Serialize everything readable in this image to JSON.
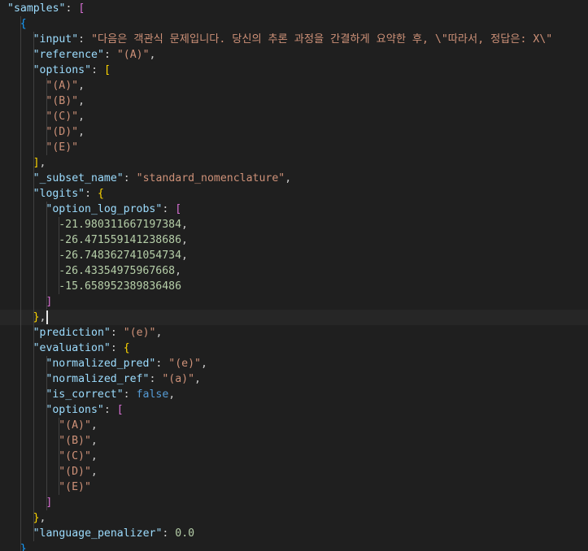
{
  "editor": {
    "language": "json",
    "colors": {
      "background": "#1f1f1f",
      "key": "#9cdcfe",
      "string": "#ce9178",
      "number": "#b5cea8",
      "keyword": "#569cd6",
      "punctuation": "#cccccc",
      "bracket_level1": "#ffd700",
      "bracket_level2": "#da70d6",
      "bracket_level3": "#179fff",
      "current_line": "#262626"
    },
    "lines": [
      {
        "indent": 0,
        "tokens": [
          {
            "t": "key",
            "v": "\"samples\""
          },
          {
            "t": "punct",
            "v": ": "
          },
          {
            "t": "b2",
            "v": "["
          }
        ]
      },
      {
        "indent": 1,
        "tokens": [
          {
            "t": "b3",
            "v": "{"
          }
        ]
      },
      {
        "indent": 2,
        "tokens": [
          {
            "t": "key",
            "v": "\"input\""
          },
          {
            "t": "punct",
            "v": ": "
          },
          {
            "t": "str",
            "v": "\"다음은 객관식 문제입니다. 당신의 추론 과정을 간결하게 요약한 후, \\\"따라서, 정답은: X\\\""
          }
        ]
      },
      {
        "indent": 2,
        "tokens": [
          {
            "t": "key",
            "v": "\"reference\""
          },
          {
            "t": "punct",
            "v": ": "
          },
          {
            "t": "str",
            "v": "\"(A)\""
          },
          {
            "t": "punct",
            "v": ","
          }
        ]
      },
      {
        "indent": 2,
        "tokens": [
          {
            "t": "key",
            "v": "\"options\""
          },
          {
            "t": "punct",
            "v": ": "
          },
          {
            "t": "b1",
            "v": "["
          }
        ]
      },
      {
        "indent": 3,
        "tokens": [
          {
            "t": "str",
            "v": "\"(A)\""
          },
          {
            "t": "punct",
            "v": ","
          }
        ]
      },
      {
        "indent": 3,
        "tokens": [
          {
            "t": "str",
            "v": "\"(B)\""
          },
          {
            "t": "punct",
            "v": ","
          }
        ]
      },
      {
        "indent": 3,
        "tokens": [
          {
            "t": "str",
            "v": "\"(C)\""
          },
          {
            "t": "punct",
            "v": ","
          }
        ]
      },
      {
        "indent": 3,
        "tokens": [
          {
            "t": "str",
            "v": "\"(D)\""
          },
          {
            "t": "punct",
            "v": ","
          }
        ]
      },
      {
        "indent": 3,
        "tokens": [
          {
            "t": "str",
            "v": "\"(E)\""
          }
        ]
      },
      {
        "indent": 2,
        "tokens": [
          {
            "t": "b1",
            "v": "]"
          },
          {
            "t": "punct",
            "v": ","
          }
        ]
      },
      {
        "indent": 2,
        "tokens": [
          {
            "t": "key",
            "v": "\"_subset_name\""
          },
          {
            "t": "punct",
            "v": ": "
          },
          {
            "t": "str",
            "v": "\"standard_nomenclature\""
          },
          {
            "t": "punct",
            "v": ","
          }
        ]
      },
      {
        "indent": 2,
        "tokens": [
          {
            "t": "key",
            "v": "\"logits\""
          },
          {
            "t": "punct",
            "v": ": "
          },
          {
            "t": "b1",
            "v": "{"
          }
        ]
      },
      {
        "indent": 3,
        "tokens": [
          {
            "t": "key",
            "v": "\"option_log_probs\""
          },
          {
            "t": "punct",
            "v": ": "
          },
          {
            "t": "b2",
            "v": "["
          }
        ]
      },
      {
        "indent": 4,
        "tokens": [
          {
            "t": "num",
            "v": "-21.980311667197384"
          },
          {
            "t": "punct",
            "v": ","
          }
        ]
      },
      {
        "indent": 4,
        "tokens": [
          {
            "t": "num",
            "v": "-26.471559141238686"
          },
          {
            "t": "punct",
            "v": ","
          }
        ]
      },
      {
        "indent": 4,
        "tokens": [
          {
            "t": "num",
            "v": "-26.748362741054734"
          },
          {
            "t": "punct",
            "v": ","
          }
        ]
      },
      {
        "indent": 4,
        "tokens": [
          {
            "t": "num",
            "v": "-26.43354975967668"
          },
          {
            "t": "punct",
            "v": ","
          }
        ]
      },
      {
        "indent": 4,
        "tokens": [
          {
            "t": "num",
            "v": "-15.658952389836486"
          }
        ]
      },
      {
        "indent": 3,
        "tokens": [
          {
            "t": "b2",
            "v": "]"
          }
        ]
      },
      {
        "indent": 2,
        "tokens": [
          {
            "t": "b1",
            "v": "}"
          },
          {
            "t": "punct",
            "v": ","
          }
        ]
      },
      {
        "indent": 2,
        "tokens": [
          {
            "t": "key",
            "v": "\"prediction\""
          },
          {
            "t": "punct",
            "v": ": "
          },
          {
            "t": "str",
            "v": "\"(e)\""
          },
          {
            "t": "punct",
            "v": ","
          }
        ]
      },
      {
        "indent": 2,
        "tokens": [
          {
            "t": "key",
            "v": "\"evaluation\""
          },
          {
            "t": "punct",
            "v": ": "
          },
          {
            "t": "b1",
            "v": "{"
          }
        ]
      },
      {
        "indent": 3,
        "tokens": [
          {
            "t": "key",
            "v": "\"normalized_pred\""
          },
          {
            "t": "punct",
            "v": ": "
          },
          {
            "t": "str",
            "v": "\"(e)\""
          },
          {
            "t": "punct",
            "v": ","
          }
        ]
      },
      {
        "indent": 3,
        "tokens": [
          {
            "t": "key",
            "v": "\"normalized_ref\""
          },
          {
            "t": "punct",
            "v": ": "
          },
          {
            "t": "str",
            "v": "\"(a)\""
          },
          {
            "t": "punct",
            "v": ","
          }
        ]
      },
      {
        "indent": 3,
        "tokens": [
          {
            "t": "key",
            "v": "\"is_correct\""
          },
          {
            "t": "punct",
            "v": ": "
          },
          {
            "t": "kw",
            "v": "false"
          },
          {
            "t": "punct",
            "v": ","
          }
        ]
      },
      {
        "indent": 3,
        "tokens": [
          {
            "t": "key",
            "v": "\"options\""
          },
          {
            "t": "punct",
            "v": ": "
          },
          {
            "t": "b2",
            "v": "["
          }
        ]
      },
      {
        "indent": 4,
        "tokens": [
          {
            "t": "str",
            "v": "\"(A)\""
          },
          {
            "t": "punct",
            "v": ","
          }
        ]
      },
      {
        "indent": 4,
        "tokens": [
          {
            "t": "str",
            "v": "\"(B)\""
          },
          {
            "t": "punct",
            "v": ","
          }
        ]
      },
      {
        "indent": 4,
        "tokens": [
          {
            "t": "str",
            "v": "\"(C)\""
          },
          {
            "t": "punct",
            "v": ","
          }
        ]
      },
      {
        "indent": 4,
        "tokens": [
          {
            "t": "str",
            "v": "\"(D)\""
          },
          {
            "t": "punct",
            "v": ","
          }
        ]
      },
      {
        "indent": 4,
        "tokens": [
          {
            "t": "str",
            "v": "\"(E)\""
          }
        ]
      },
      {
        "indent": 3,
        "tokens": [
          {
            "t": "b2",
            "v": "]"
          }
        ]
      },
      {
        "indent": 2,
        "tokens": [
          {
            "t": "b1",
            "v": "}"
          },
          {
            "t": "punct",
            "v": ","
          }
        ]
      },
      {
        "indent": 2,
        "tokens": [
          {
            "t": "key",
            "v": "\"language_penalizer\""
          },
          {
            "t": "punct",
            "v": ": "
          },
          {
            "t": "num",
            "v": "0.0"
          }
        ]
      },
      {
        "indent": 1,
        "tokens": [
          {
            "t": "b3",
            "v": "}"
          }
        ]
      }
    ],
    "current_line_index": 20
  }
}
